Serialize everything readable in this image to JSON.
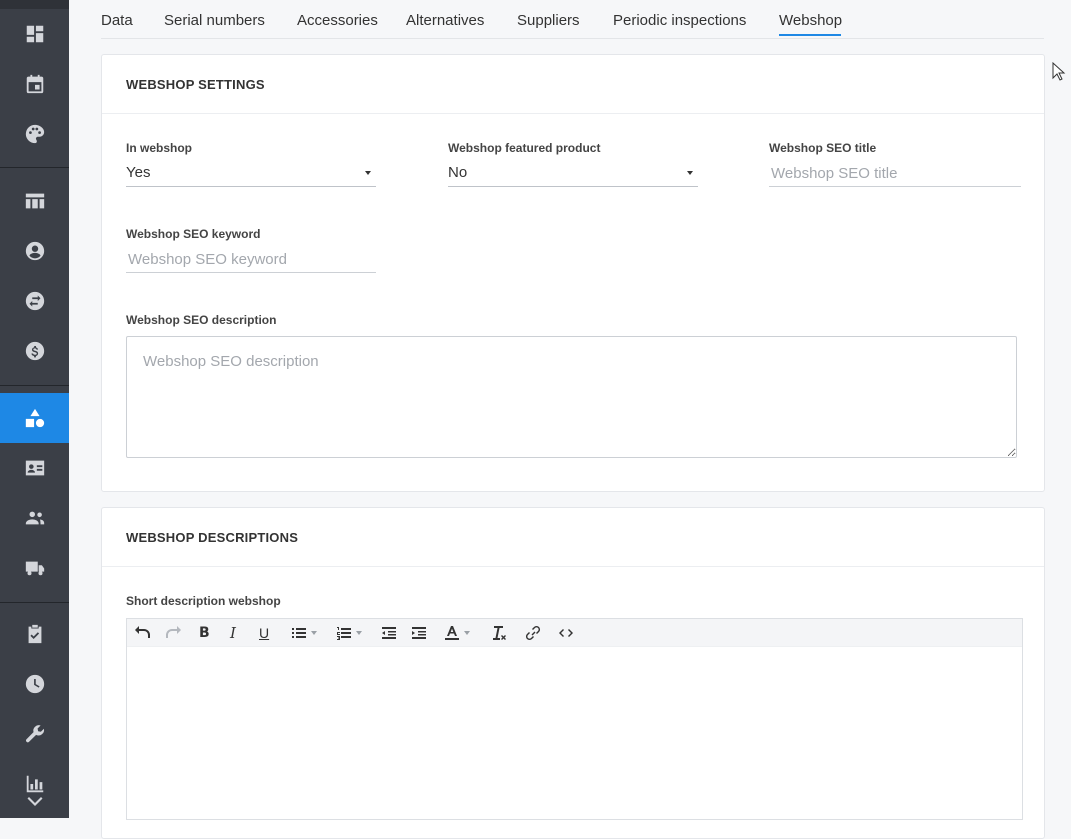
{
  "sidebar": {
    "items": [
      {
        "icon": "dashboard-icon"
      },
      {
        "icon": "calendar-icon"
      },
      {
        "icon": "palette-icon"
      },
      {
        "icon": "table-icon"
      },
      {
        "icon": "user-circle-icon"
      },
      {
        "icon": "swap-icon"
      },
      {
        "icon": "dollar-icon"
      },
      {
        "icon": "shapes-icon",
        "active": true
      },
      {
        "icon": "contact-card-icon"
      },
      {
        "icon": "people-icon"
      },
      {
        "icon": "truck-icon"
      },
      {
        "icon": "clipboard-check-icon"
      },
      {
        "icon": "clock-icon"
      },
      {
        "icon": "wrench-icon"
      },
      {
        "icon": "bar-chart-icon"
      }
    ],
    "accent_color": "#1e88e5"
  },
  "tabs": [
    "Data",
    "Serial numbers",
    "Accessories",
    "Alternatives",
    "Suppliers",
    "Periodic inspections",
    "Webshop"
  ],
  "active_tab": "Webshop",
  "webshop_settings": {
    "title": "WEBSHOP SETTINGS",
    "in_webshop": {
      "label": "In webshop",
      "value": "Yes"
    },
    "featured": {
      "label": "Webshop featured product",
      "value": "No"
    },
    "seo_title": {
      "label": "Webshop SEO title",
      "placeholder": "Webshop SEO title"
    },
    "seo_keyword": {
      "label": "Webshop SEO keyword",
      "placeholder": "Webshop SEO keyword"
    },
    "seo_description": {
      "label": "Webshop SEO description",
      "placeholder": "Webshop SEO description"
    }
  },
  "webshop_descriptions": {
    "title": "WEBSHOP DESCRIPTIONS",
    "short_description_label": "Short description webshop",
    "toolbar": [
      "undo-icon",
      "redo-icon",
      "bold-icon",
      "italic-icon",
      "underline-icon",
      "bullet-list-icon",
      "numbered-list-icon",
      "outdent-icon",
      "indent-icon",
      "text-color-icon",
      "clear-format-icon",
      "link-icon",
      "code-icon"
    ]
  }
}
